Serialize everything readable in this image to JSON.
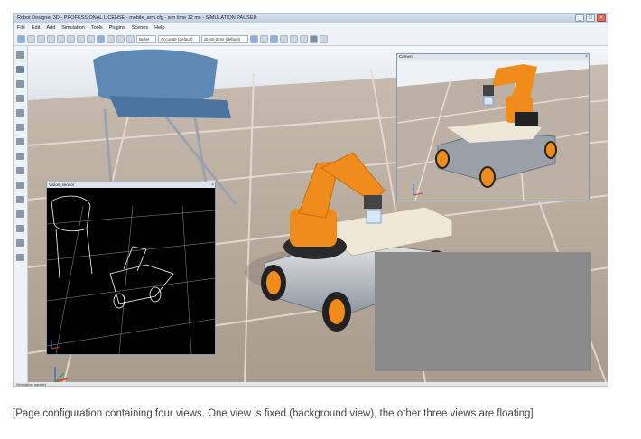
{
  "window": {
    "title": "Robot Designer 3D - PROFESSIONAL LICENSE - mobile_arm.cfg - sim time 12 ms - SIMULATION PAUSED",
    "buttons": [
      "_",
      "□",
      "×"
    ]
  },
  "menu": [
    "File",
    "Edit",
    "Add",
    "Simulation",
    "Tools",
    "Plugins",
    "Scenes",
    "Help"
  ],
  "toolbar": {
    "engine_combo": "Bullet",
    "accuracy_combo": "Accurate (default)",
    "dt_combo": "dt=50.0 ms (default)"
  },
  "floating_views": {
    "camera": {
      "title": "Camera"
    },
    "vision_sensor": {
      "title": "Vision_sensor"
    },
    "gray": {
      "title": ""
    }
  },
  "statusbar": {
    "text": "Simulation paused"
  },
  "caption": "[Page configuration containing four views. One view is fixed (background view), the other three views are floating]",
  "colors": {
    "robot_orange": "#f08c1c",
    "chair_blue": "#5f89b5",
    "floor_tile": "#b5a89a"
  }
}
